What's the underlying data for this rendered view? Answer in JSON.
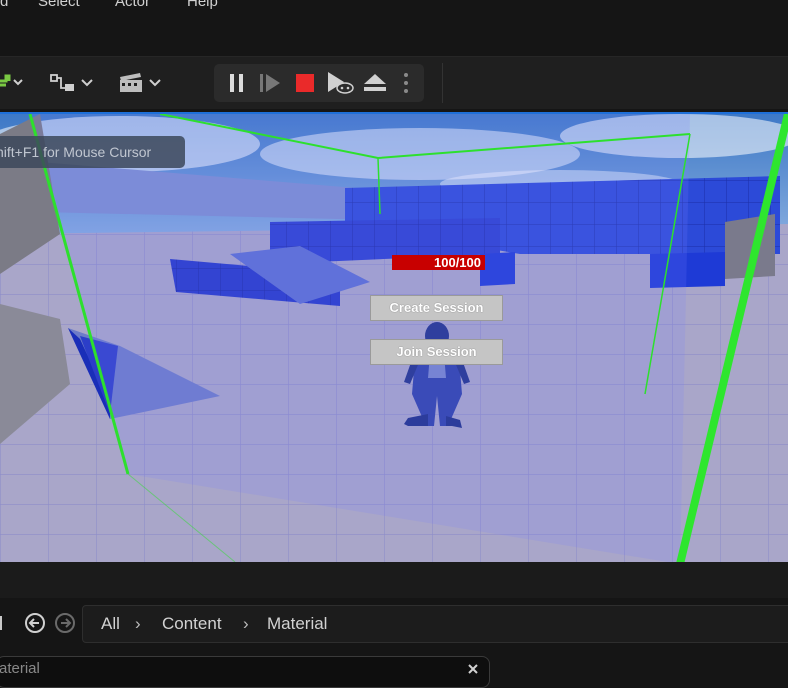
{
  "menu": [
    "d",
    "Select",
    "Actor",
    "Help"
  ],
  "toolbar": {
    "icons": [
      "add-actor-icon",
      "blueprint-icon",
      "cinematics-icon"
    ],
    "play_controls": [
      "pause-icon",
      "frame-skip-icon",
      "stop-icon",
      "eject-play-icon",
      "eject-icon",
      "more-options-icon"
    ]
  },
  "viewport": {
    "hint": "hift+F1 for Mouse Cursor",
    "health": "100/100",
    "health_fraction": 1.0,
    "create_session": "Create Session",
    "join_session": "Join Session"
  },
  "content_browser": {
    "breadcrumbs": [
      "All",
      "Content",
      "Material"
    ],
    "search_value": "aterial"
  }
}
